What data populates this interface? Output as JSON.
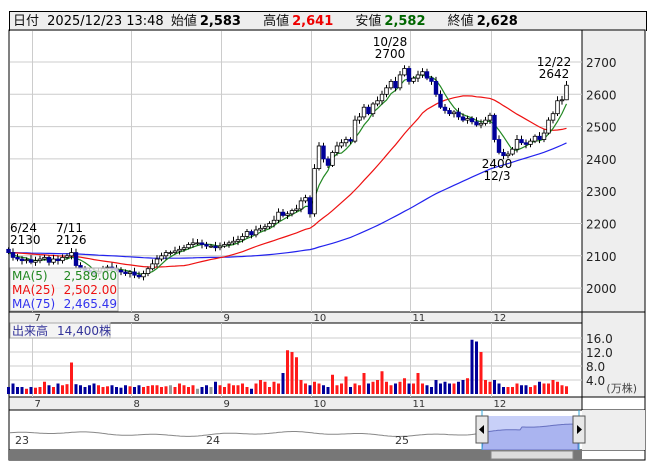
{
  "header": {
    "date_label": "日付",
    "date_value": "2025/12/23 13:48",
    "open_label": "始値",
    "open_value": "2,583",
    "high_label": "高値",
    "high_value": "2,641",
    "low_label": "安値",
    "low_value": "2,582",
    "close_label": "終値",
    "close_value": "2,628"
  },
  "legend": {
    "ma5": "MA(5)",
    "ma5_value": "2,589.00",
    "ma25": "MA(25)",
    "ma25_value": "2,502.00",
    "ma75": "MA(75)",
    "ma75_value": "2,465.49",
    "volume_label": "出来高",
    "volume_value": "14,400株"
  },
  "colors": {
    "up_fill": "#ffffff",
    "down_fill": "#000099",
    "ma5": "#228822",
    "ma25": "#ee1111",
    "ma75": "#2222ee",
    "vol_up": "#ff1a1a",
    "vol_down": "#000099",
    "vol_flat": "#999999",
    "header_high": "#ee0000",
    "header_low": "#006600"
  },
  "annotations": [
    {
      "date": "6/24",
      "price": "2130"
    },
    {
      "date": "7/11",
      "price": "2126"
    },
    {
      "date": "10/28",
      "price": "2700"
    },
    {
      "date": "12/22",
      "price": "2642"
    },
    {
      "date": "12/3",
      "price": "2400"
    }
  ],
  "volume_unit": "(万株)",
  "navigator_years": [
    "23",
    "24",
    "25"
  ],
  "chart_data": {
    "type": "candlestick",
    "period": "2025/6/23 - 2025/12/23 (daily)",
    "months": [
      "7",
      "8",
      "9",
      "10",
      "11",
      "12"
    ],
    "month_start_index": [
      6,
      28,
      48,
      68,
      90,
      108
    ],
    "price_axis": {
      "ticks": [
        "2700",
        "2600",
        "2500",
        "2400",
        "2300",
        "2200",
        "2100",
        "2000"
      ],
      "range": [
        1960,
        2740
      ]
    },
    "volume_axis": {
      "ticks": [
        "16.0",
        "12.0",
        "8.0",
        "4.0"
      ],
      "unit": "万株",
      "range": [
        0,
        16
      ]
    },
    "open_first": 2120,
    "close": [
      2110,
      2095,
      2090,
      2085,
      2088,
      2080,
      2085,
      2090,
      2095,
      2080,
      2090,
      2085,
      2095,
      2100,
      2110,
      2070,
      2060,
      2055,
      2050,
      2045,
      2050,
      2060,
      2065,
      2060,
      2055,
      2050,
      2045,
      2050,
      2040,
      2035,
      2045,
      2060,
      2075,
      2090,
      2100,
      2110,
      2110,
      2115,
      2120,
      2125,
      2135,
      2140,
      2140,
      2135,
      2130,
      2130,
      2125,
      2130,
      2135,
      2140,
      2145,
      2150,
      2160,
      2175,
      2165,
      2180,
      2185,
      2190,
      2200,
      2210,
      2235,
      2225,
      2230,
      2240,
      2245,
      2270,
      2280,
      2230,
      2370,
      2440,
      2400,
      2380,
      2420,
      2440,
      2450,
      2460,
      2455,
      2520,
      2530,
      2560,
      2540,
      2570,
      2580,
      2600,
      2620,
      2640,
      2620,
      2660,
      2680,
      2640,
      2650,
      2660,
      2670,
      2650,
      2640,
      2600,
      2560,
      2550,
      2540,
      2545,
      2530,
      2520,
      2525,
      2515,
      2505,
      2510,
      2520,
      2535,
      2460,
      2420,
      2410,
      2415,
      2430,
      2460,
      2450,
      2445,
      2455,
      2470,
      2460,
      2480,
      2520,
      2540,
      2580,
      2583,
      2628
    ],
    "last_candle": {
      "open": 2583,
      "high": 2641,
      "low": 2582,
      "close": 2628
    },
    "volume": [
      2.0,
      3.0,
      2.0,
      2.0,
      1.5,
      2.0,
      1.8,
      2.0,
      3.5,
      2.5,
      2.0,
      3.0,
      2.5,
      2.8,
      9.0,
      2.8,
      2.5,
      2.0,
      2.5,
      3.0,
      2.5,
      2.0,
      2.2,
      2.5,
      2.0,
      1.8,
      2.5,
      2.2,
      2.0,
      2.5,
      2.0,
      2.3,
      2.5,
      2.5,
      2.0,
      2.2,
      2.5,
      2.0,
      3.0,
      2.5,
      2.0,
      2.5,
      1.5,
      2.0,
      2.5,
      2.0,
      3.5,
      2.5,
      2.0,
      3.0,
      2.5,
      2.5,
      3.0,
      2.0,
      1.5,
      3.0,
      4.0,
      3.5,
      2.0,
      3.5,
      3.0,
      6.0,
      12.5,
      12.0,
      10.5,
      4.0,
      3.0,
      2.5,
      3.5,
      3.0,
      2.5,
      2.0,
      5.5,
      2.5,
      3.0,
      5.0,
      2.0,
      3.0,
      2.5,
      6.0,
      3.0,
      3.5,
      4.0,
      6.5,
      3.5,
      2.5,
      3.0,
      3.5,
      4.5,
      3.0,
      3.0,
      6.0,
      3.0,
      2.5,
      2.0,
      4.0,
      3.0,
      3.5,
      3.0,
      3.0,
      3.5,
      4.0,
      4.5,
      15.5,
      15.0,
      12.0,
      4.0,
      3.5,
      4.0,
      3.0,
      2.0,
      2.0,
      2.0,
      3.0,
      2.5,
      2.5,
      2.0,
      2.5,
      3.5,
      3.0,
      3.0,
      4.0,
      3.5,
      2.5,
      2.2
    ]
  }
}
